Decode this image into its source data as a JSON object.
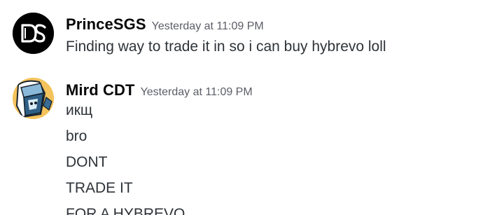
{
  "messages": [
    {
      "username": "PrinceSGS",
      "timestamp": "Yesterday at 11:09 PM",
      "avatar_icon": "ds-logo-icon",
      "avatar_text": "DS",
      "lines": [
        "Finding way to trade it in so i can buy hybrevo loll"
      ]
    },
    {
      "username": "Mird CDT",
      "timestamp": "Yesterday at 11:09 PM",
      "avatar_icon": "anime-character-avatar-icon",
      "lines": [
        "икщ",
        "bro",
        "DONT",
        "TRADE IT",
        "FOR A HYBREVO"
      ]
    }
  ],
  "colors": {
    "username": "#060607",
    "timestamp": "#5c5e66",
    "text": "#2e3338",
    "avatar1_bg": "#000000"
  }
}
